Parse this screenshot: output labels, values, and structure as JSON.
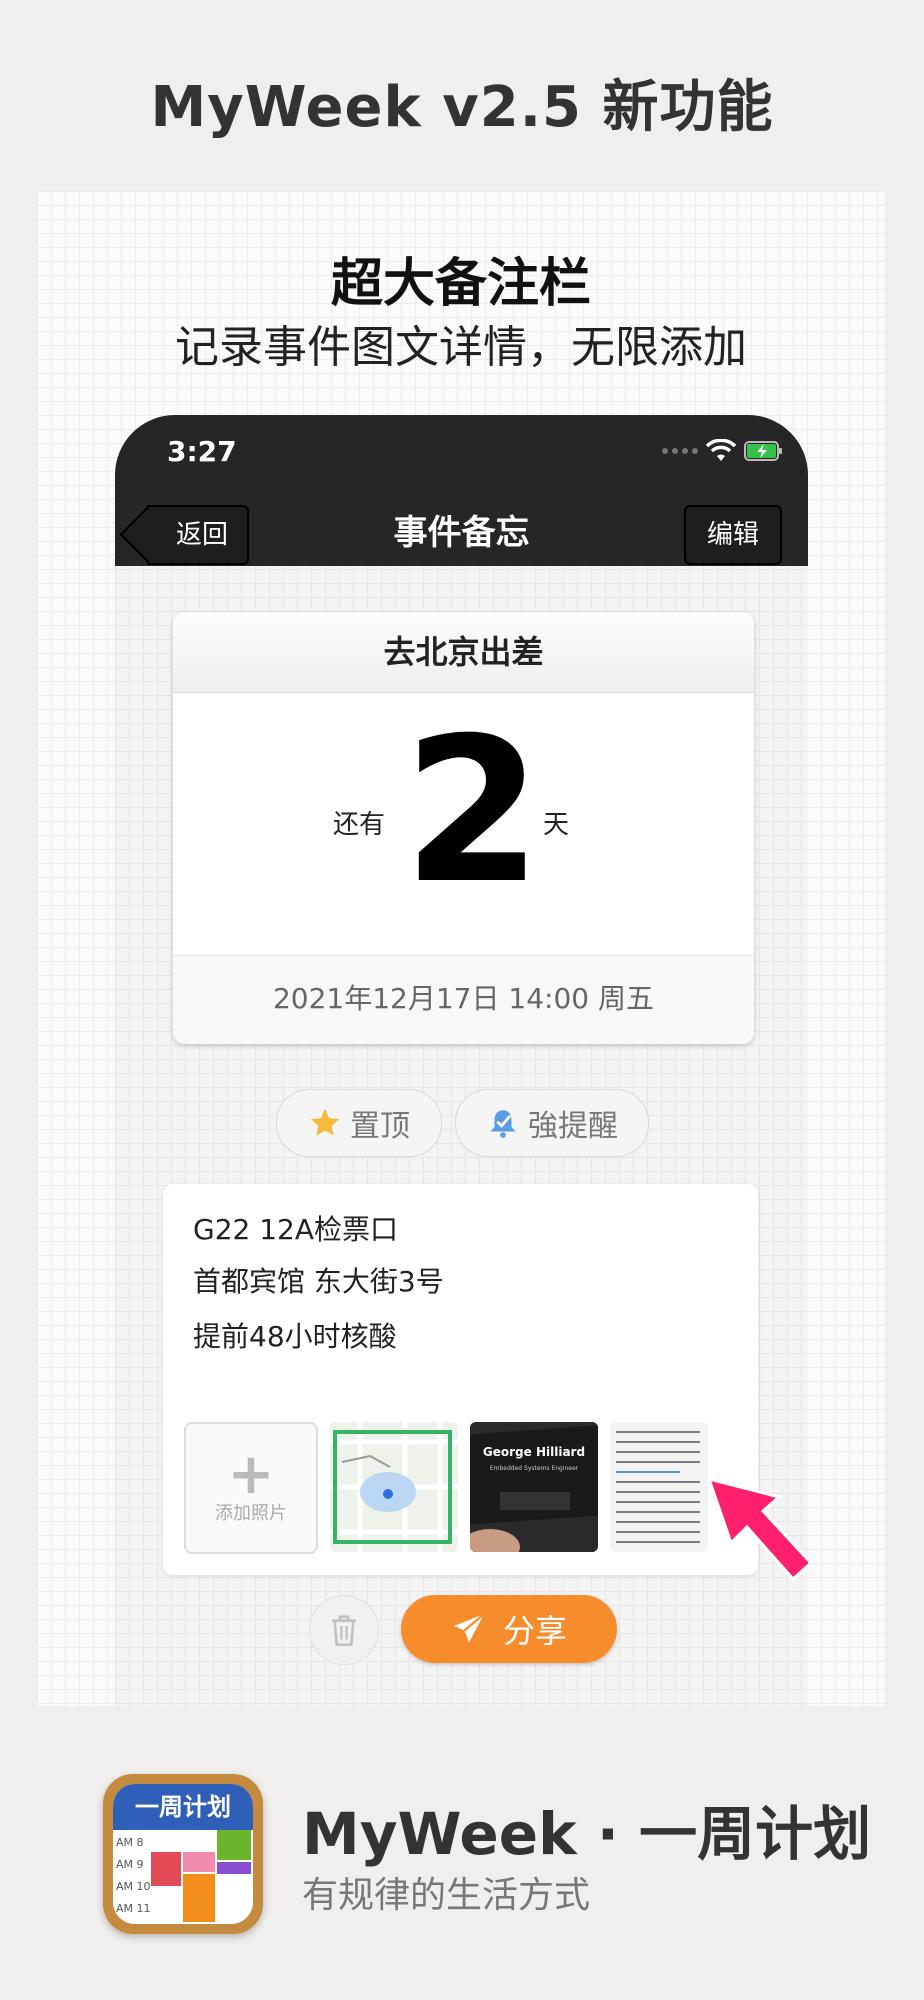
{
  "page": {
    "title": "MyWeek v2.5  新功能",
    "headline": "超大备注栏",
    "subheadline": "记录事件图文详情，无限添加"
  },
  "status_bar": {
    "time": "3:27"
  },
  "nav": {
    "back_label": "返回",
    "title": "事件备忘",
    "edit_label": "编辑"
  },
  "event": {
    "title": "去北京出差",
    "countdown_prefix": "还有",
    "countdown_value": "2",
    "countdown_suffix": "天",
    "datetime": "2021年12月17日 14:00 周五"
  },
  "actions": {
    "pin_label": "置顶",
    "remind_label": "強提醒",
    "share_label": "分享"
  },
  "notes": {
    "lines": [
      "G22  12A检票口",
      "首都宾馆 东大街3号",
      "提前48小时核酸"
    ],
    "add_photo_label": "添加照片",
    "photos": [
      {
        "kind": "map"
      },
      {
        "kind": "business-card",
        "name": "George Hilliard",
        "role": "Embedded Systems Engineer"
      },
      {
        "kind": "document"
      }
    ]
  },
  "app": {
    "icon_label": "一周计划",
    "icon_rows": [
      "AM 8",
      "AM 9",
      "AM 10",
      "AM 11"
    ],
    "name": "MyWeek · 一周计划",
    "tagline": "有规律的生活方式"
  },
  "colors": {
    "highlight": "#fff200",
    "accent_orange": "#f78c2c",
    "arrow_pink": "#ff1f6d",
    "nav_bg": "#262626"
  }
}
